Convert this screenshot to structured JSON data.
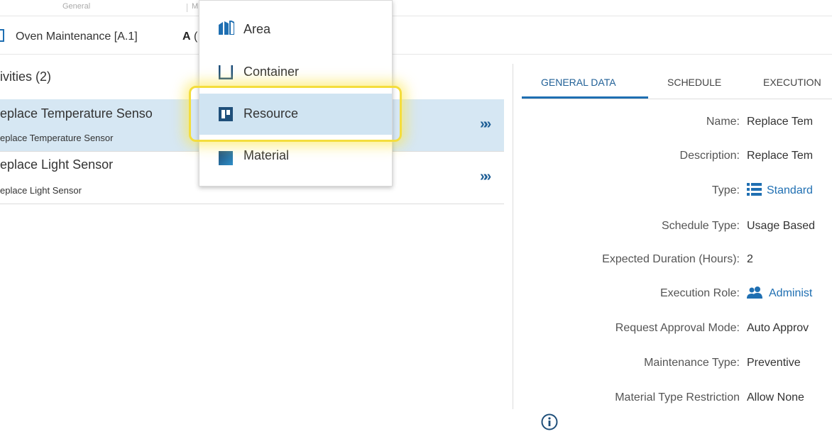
{
  "top_strip": {
    "left_label": "General",
    "right_label": "M"
  },
  "breadcrumb": {
    "title": "Oven Maintenance [A.1]",
    "bold": "A",
    "paren": "("
  },
  "activities": {
    "title": "ivities (2)",
    "items": [
      {
        "main": "eplace Temperature Senso",
        "sub": "eplace Temperature Sensor"
      },
      {
        "main": "eplace Light Sensor",
        "sub": "eplace Light Sensor"
      }
    ],
    "chevron": "»»"
  },
  "tabs": [
    "GENERAL DATA",
    "SCHEDULE",
    "EXECUTION"
  ],
  "fields": [
    {
      "label": "Name:",
      "value": "Replace Tem"
    },
    {
      "label": "Description:",
      "value": "Replace Tem"
    },
    {
      "label": "Type:",
      "value": "Standard"
    },
    {
      "label": "Schedule Type:",
      "value": "Usage Based"
    },
    {
      "label": "Expected Duration (Hours):",
      "value": "2"
    },
    {
      "label": "Execution Role:",
      "value": "Administ"
    },
    {
      "label": "Request Approval Mode:",
      "value": "Auto Approv"
    },
    {
      "label": "Maintenance Type:",
      "value": "Preventive"
    },
    {
      "label": "Material Type Restriction",
      "value": "Allow None"
    }
  ],
  "menu": {
    "items": [
      "Area",
      "Container",
      "Resource",
      "Material"
    ],
    "highlighted": "Resource"
  },
  "colors": {
    "accent": "#1f6fb2",
    "highlight": "#d0e4f2",
    "selected_row": "#d6e7f3",
    "glow": "#f4dd3c"
  }
}
